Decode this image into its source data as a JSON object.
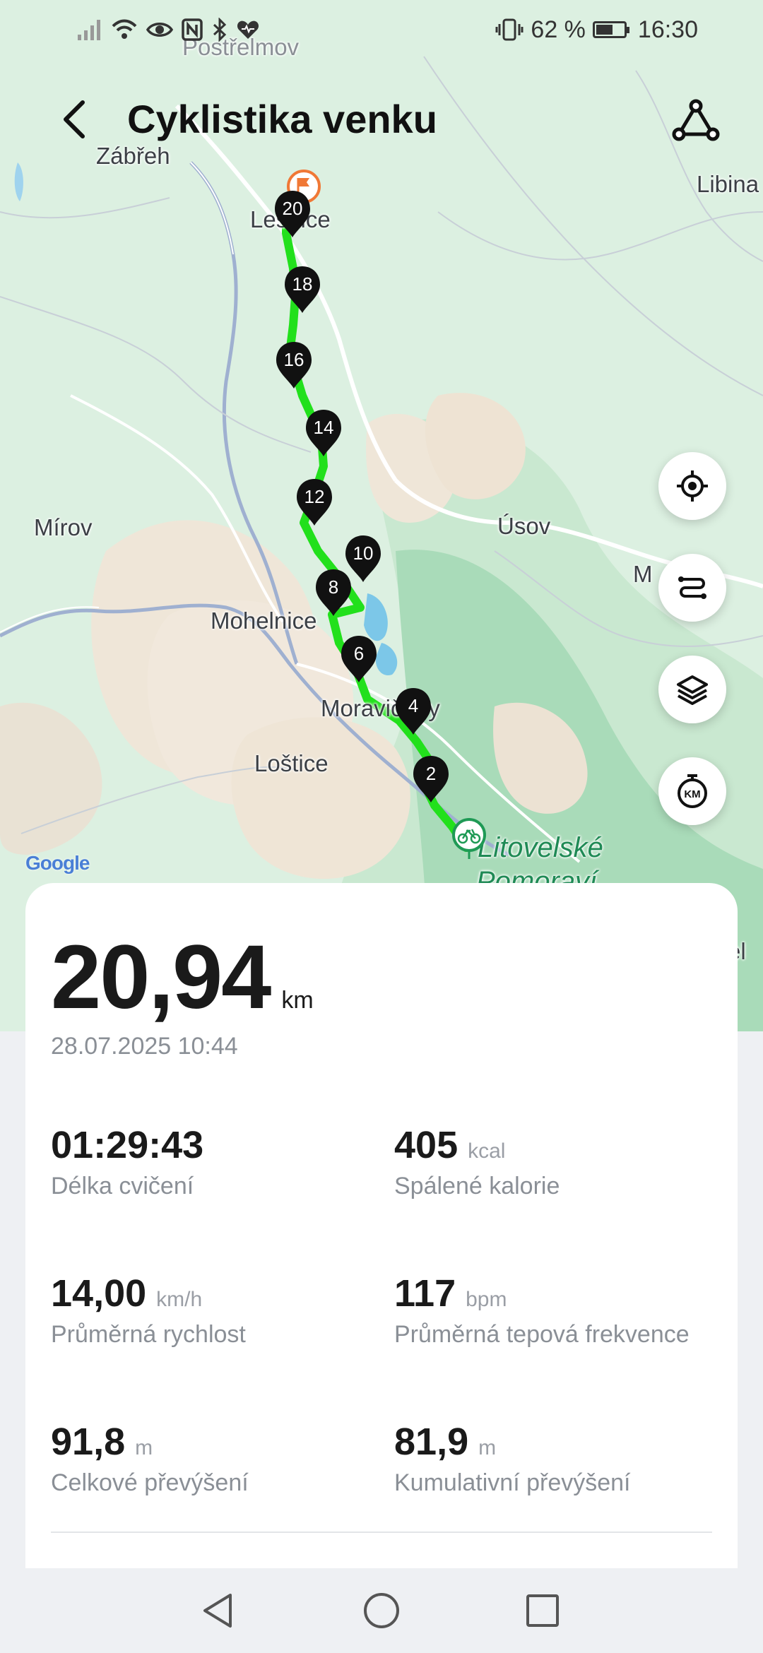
{
  "status_bar": {
    "battery_percent": "62 %",
    "battery_level": 0.62,
    "time": "16:30",
    "icons": [
      "signal-icon",
      "wifi-icon",
      "eye-icon",
      "nfc-icon",
      "bluetooth-icon",
      "heart-icon",
      "vibrate-icon",
      "battery-icon"
    ]
  },
  "header": {
    "title": "Cyklistika venku",
    "back_icon": "back-arrow-icon",
    "share_icon": "route-share-icon"
  },
  "map": {
    "places": {
      "postrelmov": "Postřelmov",
      "zabreh": "Zábřeh",
      "libina": "Libina",
      "lesnice": "Lesnice",
      "mirov": "Mírov",
      "usov": "Úsov",
      "m_partial": "M",
      "mohelnice": "Mohelnice",
      "moravicany": "Moravičany",
      "lostice": "Loštice",
      "litovelske": "Litovelské",
      "pomoravi": "Pomoraví",
      "el_partial": "el"
    },
    "route_color": "#22e01c",
    "km_markers": [
      "2",
      "4",
      "6",
      "8",
      "10",
      "12",
      "14",
      "16",
      "18",
      "20"
    ],
    "start_icon": "bike-start-icon",
    "finish_icon": "finish-flag-icon",
    "attribution": "Google",
    "controls": [
      {
        "name": "locate-button",
        "icon": "target-icon"
      },
      {
        "name": "route-toggle-button",
        "icon": "route-icon"
      },
      {
        "name": "map-layers-button",
        "icon": "layers-icon"
      },
      {
        "name": "km-pace-button",
        "icon": "stopwatch-km-icon"
      }
    ],
    "km_icon_text": "KM"
  },
  "summary": {
    "distance": "20,94",
    "distance_unit": "km",
    "date": "28.07.2025 10:44",
    "stats": [
      {
        "value": "01:29:43",
        "unit": "",
        "label": "Délka cvičení"
      },
      {
        "value": "405",
        "unit": "kcal",
        "label": "Spálené kalorie"
      },
      {
        "value": "14,00",
        "unit": "km/h",
        "label": "Průměrná rychlost"
      },
      {
        "value": "117",
        "unit": "bpm",
        "label": "Průměrná tepová frekvence"
      },
      {
        "value": "91,8",
        "unit": "m",
        "label": "Celkové převýšení"
      },
      {
        "value": "81,9",
        "unit": "m",
        "label": "Kumulativní převýšení"
      }
    ]
  },
  "navigation": {
    "buttons": [
      "back-nav-icon",
      "home-nav-icon",
      "recents-nav-icon"
    ]
  }
}
